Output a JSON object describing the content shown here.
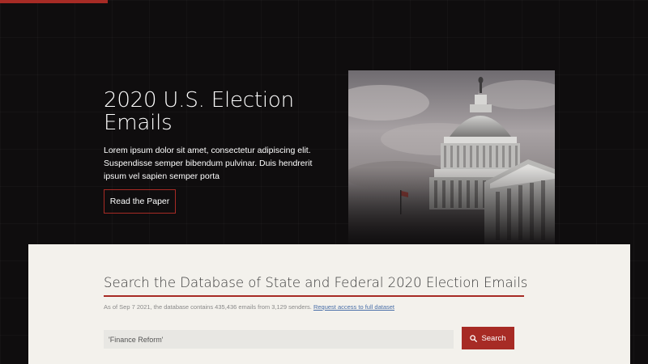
{
  "hero": {
    "title": "2020 U.S. Election Emails",
    "description": "Lorem ipsum dolor sit amet, consectetur adipiscing elit. Suspendisse semper bibendum pulvinar. Duis hendrerit ipsum vel sapien semper porta",
    "button_label": "Read the Paper",
    "image_icon": "capitol-building-image"
  },
  "search": {
    "title": "Search the Database of State and Federal 2020 Election Emails",
    "info_text": "As of Sep 7 2021, the database contains 435,436 emails from 3,129 senders.",
    "info_link": "Request access to full dataset",
    "input_value": "'Finance Reform'",
    "button_label": "Search",
    "button_icon": "search-icon"
  },
  "colors": {
    "accent": "#a72b25",
    "background": "#0f0d0e",
    "panel": "#f3f1ec"
  }
}
